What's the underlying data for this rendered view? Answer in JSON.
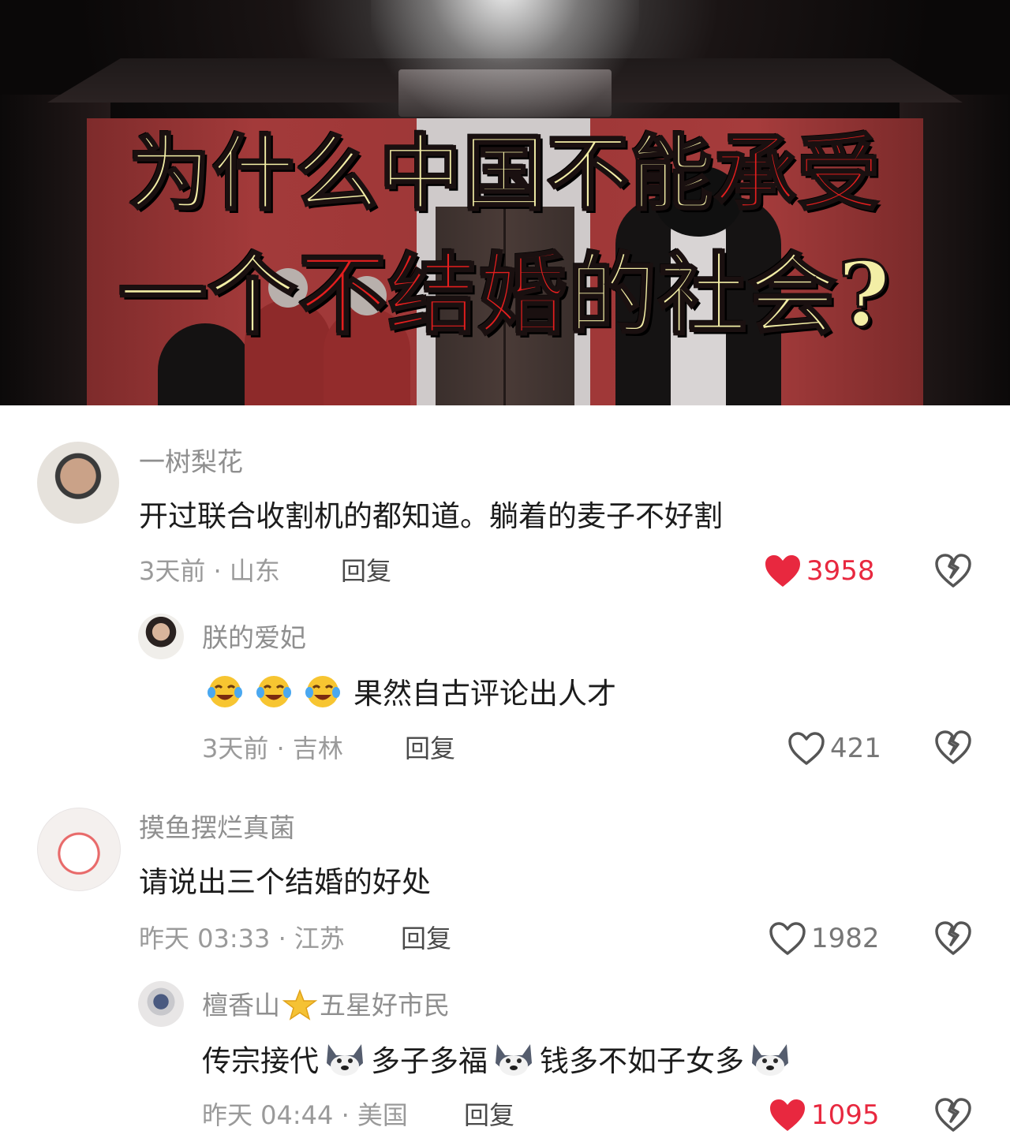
{
  "banner": {
    "title_line1_a": "为什么中国不能",
    "title_line1_b": "承受",
    "title_line2_a": "一个",
    "title_line2_b": "不结婚",
    "title_line2_c": "的社会?",
    "colors": {
      "cream": "#f3eea6",
      "red": "#e41e1e"
    }
  },
  "comments": [
    {
      "username": "一树梨花",
      "text": "开过联合收割机的都知道。躺着的麦子不好割",
      "meta": "3天前 · 山东",
      "reply_label": "回复",
      "likes": "3958",
      "liked": true,
      "replies": [
        {
          "username": "朕的爱妃",
          "text": "果然自古评论出人才",
          "emojis": [
            "laughing-tears-emoji",
            "laughing-tears-emoji",
            "laughing-tears-emoji"
          ],
          "meta": "3天前 · 吉林",
          "reply_label": "回复",
          "likes": "421",
          "liked": false
        }
      ]
    },
    {
      "username": "摸鱼摆烂真菌",
      "text": "请说出三个结婚的好处",
      "meta": "昨天 03:33 · 江苏",
      "reply_label": "回复",
      "likes": "1982",
      "liked": false,
      "replies": [
        {
          "username_a": "檀香山",
          "username_b": "五星好市民",
          "segments": [
            "传宗接代",
            "多子多福",
            "钱多不如子女多"
          ],
          "emojis": [
            "husky-emoji",
            "husky-emoji",
            "husky-emoji"
          ],
          "meta": "昨天 04:44 · 美国",
          "reply_label": "回复",
          "likes": "1095",
          "liked": true
        }
      ]
    }
  ],
  "colors": {
    "like_red": "#e8283f",
    "meta_gray": "#9a9a9a",
    "username_gray": "#8f8f8f"
  }
}
